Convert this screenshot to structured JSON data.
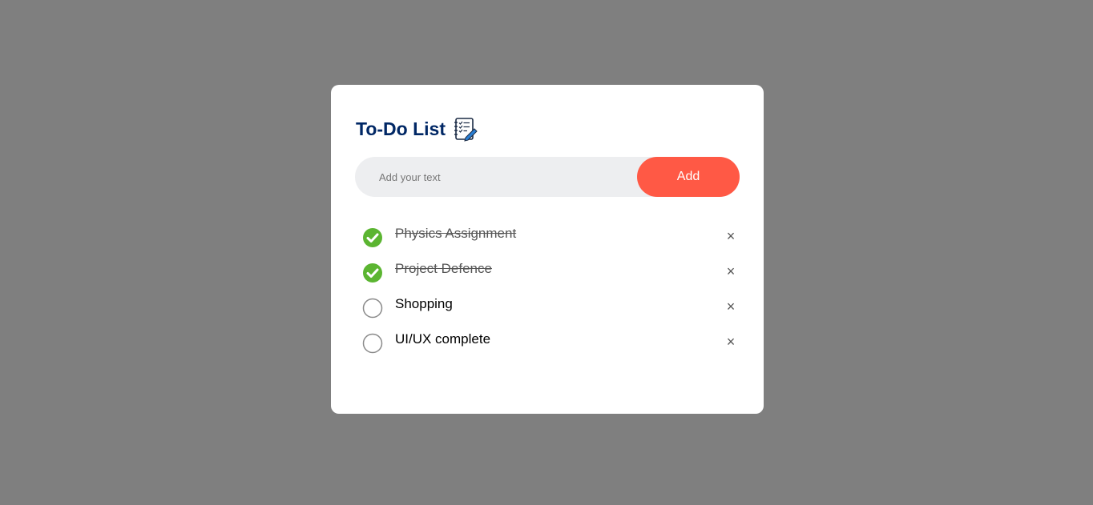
{
  "header": {
    "title": "To-Do List",
    "icon": "notepad-checklist-icon"
  },
  "input": {
    "placeholder": "Add your text",
    "value": "",
    "add_label": "Add"
  },
  "colors": {
    "title": "#002765",
    "accent": "#ff5945",
    "checked": "#5bb531",
    "background": "#7f7f7f"
  },
  "tasks": [
    {
      "label": "Physics Assignment",
      "done": true,
      "delete_label": "×"
    },
    {
      "label": "Project Defence",
      "done": true,
      "delete_label": "×"
    },
    {
      "label": "Shopping",
      "done": false,
      "delete_label": "×"
    },
    {
      "label": "UI/UX complete",
      "done": false,
      "delete_label": "×"
    }
  ]
}
